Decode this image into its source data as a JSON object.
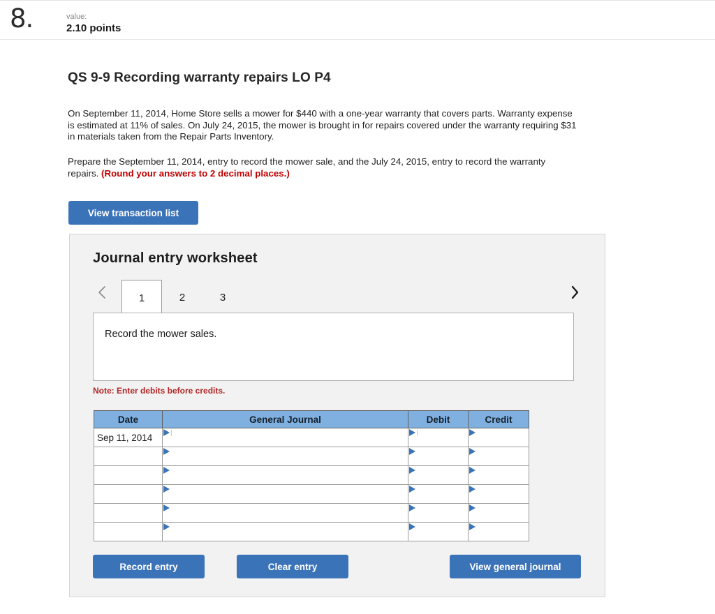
{
  "header": {
    "question_number": "8.",
    "value_label": "value:",
    "points": "2.10 points"
  },
  "question": {
    "title": "QS 9-9 Recording warranty repairs LO P4",
    "paragraph_1": "On September 11, 2014, Home Store sells a mower for $440 with a one-year warranty that covers parts. Warranty expense is estimated at 11% of sales. On July 24, 2015, the mower is brought in for repairs covered under the warranty requiring $31 in materials taken from the Repair Parts Inventory.",
    "paragraph_2_plain": "Prepare the September 11, 2014, entry to record the mower sale, and the July 24, 2015, entry to record the warranty repairs. ",
    "paragraph_2_emphasis": "(Round your answers to 2 decimal places.)"
  },
  "toolbar": {
    "view_transaction_list_label": "View transaction list"
  },
  "worksheet": {
    "title": "Journal entry worksheet",
    "prev_icon": "chevron-left-icon",
    "next_icon": "chevron-right-icon",
    "tabs": [
      {
        "label": "1",
        "active": true
      },
      {
        "label": "2",
        "active": false
      },
      {
        "label": "3",
        "active": false
      }
    ],
    "instruction": "Record the mower sales.",
    "note": "Note: Enter debits before credits.",
    "table": {
      "columns": [
        "Date",
        "General Journal",
        "Debit",
        "Credit"
      ],
      "rows": [
        {
          "date": "Sep 11, 2014",
          "general_journal": "",
          "debit": "",
          "credit": ""
        },
        {
          "date": "",
          "general_journal": "",
          "debit": "",
          "credit": ""
        },
        {
          "date": "",
          "general_journal": "",
          "debit": "",
          "credit": ""
        },
        {
          "date": "",
          "general_journal": "",
          "debit": "",
          "credit": ""
        },
        {
          "date": "",
          "general_journal": "",
          "debit": "",
          "credit": ""
        },
        {
          "date": "",
          "general_journal": "",
          "debit": "",
          "credit": ""
        }
      ]
    },
    "actions": {
      "record_entry_label": "Record entry",
      "clear_entry_label": "Clear entry",
      "view_general_journal_label": "View general journal"
    }
  },
  "colors": {
    "button_blue": "#3b73b9",
    "table_header_blue": "#7fb0e0",
    "panel_gray": "#f2f2f2",
    "note_red": "#b42323",
    "emphasis_red": "#c00000"
  }
}
